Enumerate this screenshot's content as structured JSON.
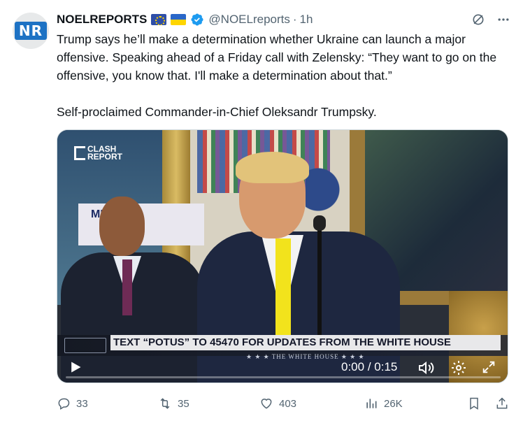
{
  "account": {
    "display_name": "NOELREPORTS",
    "avatar_text": "NR",
    "handle": "@NOELreports",
    "separator": "·",
    "time": "1h",
    "flags": [
      "eu-flag",
      "ukraine-flag"
    ],
    "verified": true
  },
  "tweet": {
    "paragraph1": "Trump says he’ll make a determination whether Ukraine can launch a major offensive. Speaking ahead of a Friday call with Zelensky: “They want to go on the offensive, you know that. I'll make a determination about that.”",
    "paragraph2": "Self-proclaimed Commander-in-Chief Oleksandr Trumpsky."
  },
  "video": {
    "watermark_line1": "CLASH",
    "watermark_line2": "REPORT",
    "banner_text": "MER HE",
    "lower_third": "TEXT “POTUS” TO 45470 FOR UPDATES FROM THE WHITE HOUSE",
    "lower_third_sub": "★ ★ ★  THE WHITE HOUSE  ★ ★ ★",
    "time_current": "0:00",
    "time_separator": "/",
    "time_total": "0:15",
    "progress": 0.0,
    "accent_color": "#1d9bf0"
  },
  "actions": {
    "replies": "33",
    "retweets": "35",
    "likes": "403",
    "views": "26K"
  },
  "colors": {
    "text_primary": "#0f1419",
    "text_secondary": "#536471",
    "verified_blue": "#1d9bf0"
  }
}
